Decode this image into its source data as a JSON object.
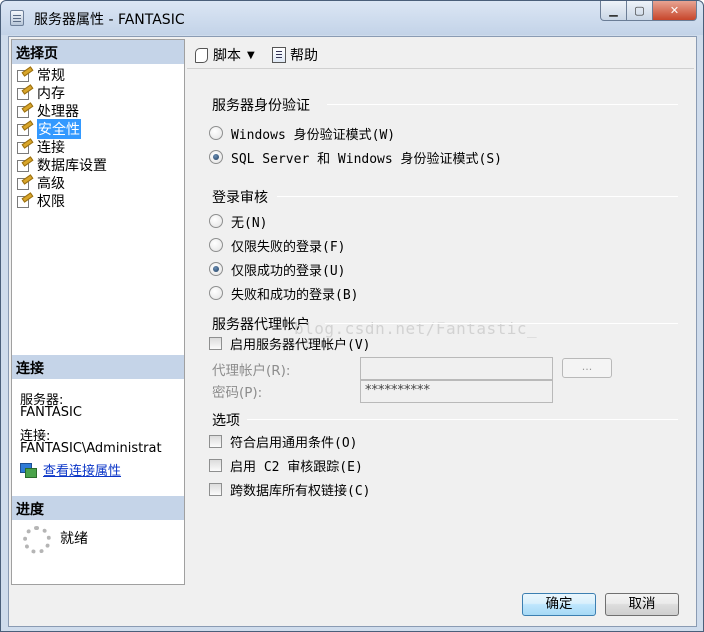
{
  "window": {
    "title": "服务器属性 - FANTASIC",
    "caption": {
      "minimize": "▁",
      "maximize": "▢",
      "close": "✕"
    }
  },
  "left": {
    "select_page_header": "选择页",
    "nav_items": [
      {
        "label": "常规",
        "icon": "page-icon"
      },
      {
        "label": "内存",
        "icon": "page-icon"
      },
      {
        "label": "处理器",
        "icon": "page-icon"
      },
      {
        "label": "安全性",
        "icon": "page-icon",
        "selected": true
      },
      {
        "label": "连接",
        "icon": "page-icon"
      },
      {
        "label": "数据库设置",
        "icon": "page-icon"
      },
      {
        "label": "高级",
        "icon": "page-icon"
      },
      {
        "label": "权限",
        "icon": "page-icon"
      }
    ],
    "connection_header": "连接",
    "server_label": "服务器:",
    "server_value": "FANTASIC",
    "connection_label": "连接:",
    "connection_value": "FANTASIC\\Administrat",
    "view_connection_link": "查看连接属性",
    "progress_header": "进度",
    "progress_status": "就绪"
  },
  "toolbar": {
    "script_label": "脚本",
    "script_arrow": "▼",
    "help_label": "帮助"
  },
  "auth": {
    "title": "服务器身份验证",
    "options": [
      {
        "label": "Windows 身份验证模式(W)",
        "selected": false
      },
      {
        "label": "SQL Server 和 Windows 身份验证模式(S)",
        "selected": true
      }
    ]
  },
  "audit": {
    "title": "登录审核",
    "options": [
      {
        "label": "无(N)",
        "selected": false
      },
      {
        "label": "仅限失败的登录(F)",
        "selected": false
      },
      {
        "label": "仅限成功的登录(U)",
        "selected": true
      },
      {
        "label": "失败和成功的登录(B)",
        "selected": false
      }
    ]
  },
  "proxy": {
    "title": "服务器代理帐户",
    "watermark": "blog.csdn.net/Fantastic_",
    "enable_label": "启用服务器代理帐户(V)",
    "enable_checked": false,
    "account_label": "代理帐户(R):",
    "account_value": "",
    "browse_button": "...",
    "password_label": "密码(P):",
    "password_value": "**********"
  },
  "options": {
    "title": "选项",
    "items": [
      {
        "label": "符合启用通用条件(O)",
        "checked": false
      },
      {
        "label": "启用 C2 审核跟踪(E)",
        "checked": false
      },
      {
        "label": "跨数据库所有权链接(C)",
        "checked": false
      }
    ]
  },
  "footer": {
    "ok_label": "确定",
    "cancel_label": "取消"
  }
}
